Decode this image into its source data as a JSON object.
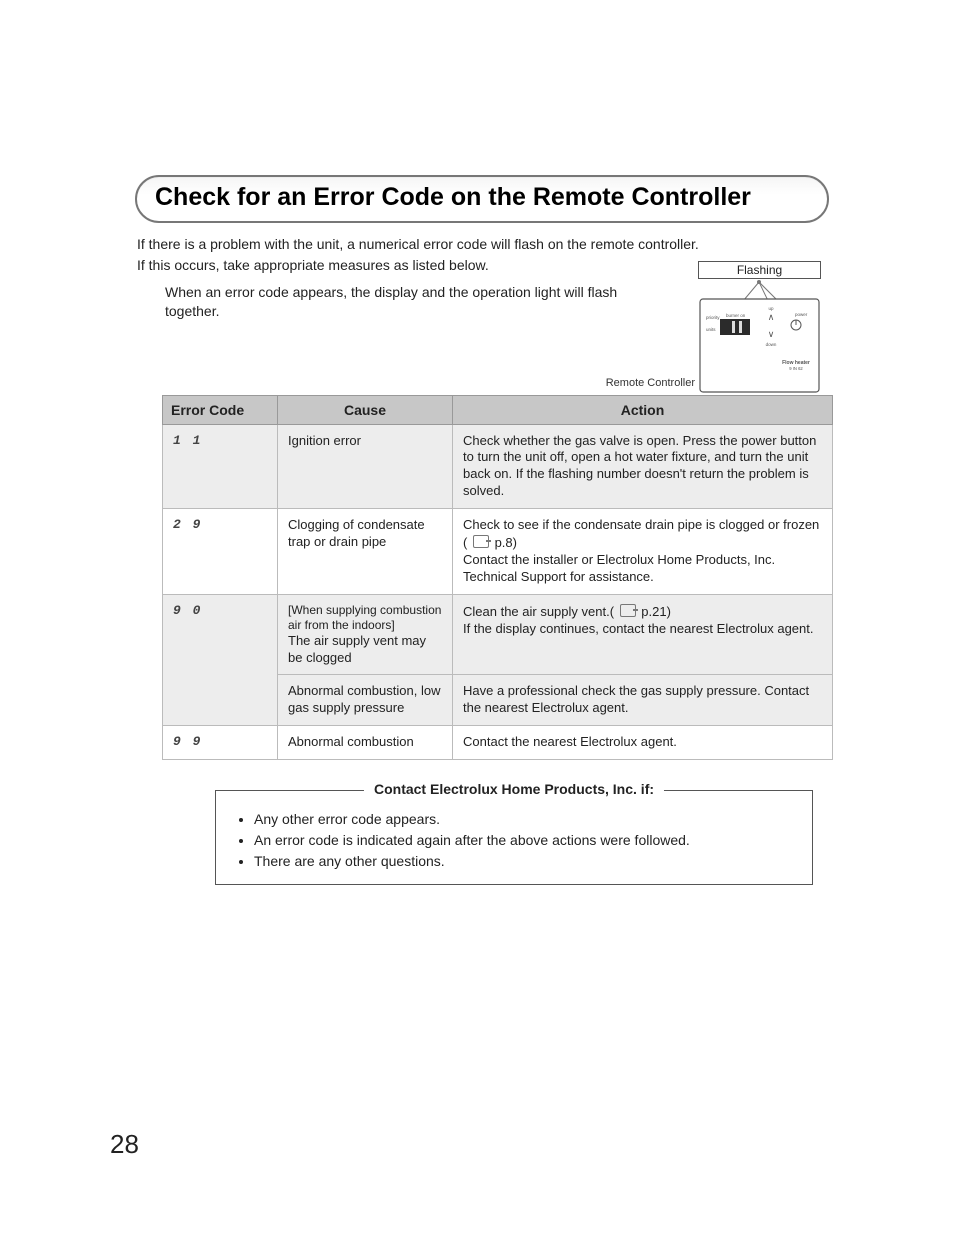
{
  "title": "Check for an Error Code on the Remote Controller",
  "intro_line1": "If there is a problem with the unit, a numerical error code will flash on the remote controller.",
  "intro_line2": "If this occurs, take appropriate measures as listed below.",
  "intro_note": "When an error code appears, the display and the operation light will flash together.",
  "flashing_label": "Flashing",
  "remote_controller_label": "Remote Controller",
  "headers": {
    "code": "Error Code",
    "cause": "Cause",
    "action": "Action"
  },
  "rows": [
    {
      "code": "1 1",
      "cause": "Ignition error",
      "action": "Check whether the gas valve is open. Press the power button to turn the unit off, open a  hot water fixture, and turn the unit back on. If the flashing number doesn't return the problem is solved."
    },
    {
      "code": "2 9",
      "cause": "Clogging of condensate trap or drain pipe",
      "action_pre": "Check to see if the condensate drain pipe is clogged or frozen ( ",
      "action_ref": "p.8",
      "action_post": ")\nContact the installer or Electrolux Home Products, Inc. Technical Support for assistance."
    },
    {
      "code": "9 0",
      "sub": [
        {
          "cause_note": "[When supplying combustion air from the indoors]",
          "cause_main": "The air supply vent may be clogged",
          "action_pre": "Clean the air supply vent.( ",
          "action_ref": "p.21",
          "action_post": ")\nIf the display continues, contact the nearest Electrolux agent."
        },
        {
          "cause_main": "Abnormal combustion, low gas supply pressure",
          "action": "Have a professional check the gas supply pressure. Contact the nearest Electrolux agent."
        }
      ]
    },
    {
      "code": "9 9",
      "cause": "Abnormal combustion",
      "action": "Contact the nearest Electrolux agent."
    }
  ],
  "contact": {
    "legend": "Contact Electrolux Home Products, Inc. if:",
    "items": [
      "Any other error code appears.",
      "An error code is indicated again after the above actions were followed.",
      "There are any other questions."
    ]
  },
  "page_number": "28"
}
